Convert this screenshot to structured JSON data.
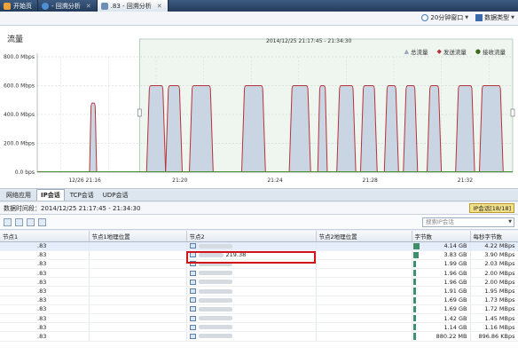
{
  "tabs": [
    {
      "label": "开始页",
      "icon": "home-icon",
      "active": false
    },
    {
      "label": "- 回溯分析",
      "icon": "globe-icon",
      "active": false
    },
    {
      "label": ".83 - 回溯分析",
      "icon": "analysis-icon",
      "active": true
    }
  ],
  "toolbar": {
    "window_label": "20分钟窗口",
    "data_type_label": "数据类型"
  },
  "chart": {
    "title": "流量",
    "overlay_range": "2014/12/25  21:17:45 - 21:34:30",
    "legend": [
      {
        "label": "总流量",
        "symbol": "▲",
        "color": "#9aa9b8"
      },
      {
        "label": "发送流量",
        "symbol": "◆",
        "color": "#b5333a"
      },
      {
        "label": "接收流量",
        "symbol": "●",
        "color": "#3e6a1f"
      }
    ]
  },
  "chart_data": {
    "type": "area",
    "ylim": [
      0,
      800
    ],
    "yticks": [
      "0.0 bps",
      "200.0 Mbps",
      "400.0 Mbps",
      "600.0 Mbps",
      "800.0 Mbps"
    ],
    "xticks": [
      "12/26 21:16",
      "21:20",
      "21:24",
      "21:28",
      "21:32"
    ],
    "grid": true,
    "legend_position": "top-right",
    "x_minutes": [
      15.0,
      17.0,
      19.0,
      21.0,
      23.0,
      25.0,
      27.0,
      29.0,
      31.0,
      33.0
    ],
    "series": [
      {
        "name": "发送流量",
        "bursts": [
          {
            "start": 16.2,
            "end": 16.5,
            "peak": 480
          },
          {
            "start": 18.6,
            "end": 19.4,
            "peak": 600
          },
          {
            "start": 19.4,
            "end": 20.1,
            "peak": 600
          },
          {
            "start": 20.4,
            "end": 21.4,
            "peak": 600
          },
          {
            "start": 22.6,
            "end": 23.6,
            "peak": 600
          },
          {
            "start": 24.6,
            "end": 25.5,
            "peak": 600
          },
          {
            "start": 25.8,
            "end": 26.2,
            "peak": 600
          },
          {
            "start": 26.6,
            "end": 27.4,
            "peak": 600
          },
          {
            "start": 27.6,
            "end": 28.3,
            "peak": 600
          },
          {
            "start": 28.6,
            "end": 29.2,
            "peak": 600
          },
          {
            "start": 29.4,
            "end": 30.0,
            "peak": 600
          },
          {
            "start": 30.4,
            "end": 31.0,
            "peak": 600
          },
          {
            "start": 31.6,
            "end": 32.4,
            "peak": 600
          },
          {
            "start": 32.6,
            "end": 33.6,
            "peak": 600
          }
        ]
      }
    ]
  },
  "subtabs": [
    {
      "label": "网络应用",
      "active": false
    },
    {
      "label": "IP会话",
      "active": true
    },
    {
      "label": "TCP会话",
      "active": false
    },
    {
      "label": "UDP会话",
      "active": false
    }
  ],
  "time_range_text": "数据时间段：2014/12/25  21:17:45 - 21:34:30",
  "session_count": "IP会话[18/18]",
  "search_placeholder": "搜索IP会话",
  "table": {
    "columns": [
      "节点1",
      "节点1地理位置",
      "节点2",
      "节点2地理位置",
      "字节数",
      "每秒字节数"
    ],
    "rows": [
      {
        "n1": ".83",
        "n2": "",
        "bytes": "4.14 GB",
        "rate": "4.22 MBps",
        "frac": 1.0
      },
      {
        "n1": ".83",
        "n2": "219.38",
        "bytes": "3.83 GB",
        "rate": "3.90 MBps",
        "frac": 0.92
      },
      {
        "n1": ".83",
        "n2": "",
        "bytes": "1.99 GB",
        "rate": "2.03 MBps",
        "frac": 0.48
      },
      {
        "n1": ".83",
        "n2": "",
        "bytes": "1.96 GB",
        "rate": "2.00 MBps",
        "frac": 0.47
      },
      {
        "n1": ".83",
        "n2": "",
        "bytes": "1.96 GB",
        "rate": "2.00 MBps",
        "frac": 0.47
      },
      {
        "n1": ".83",
        "n2": "",
        "bytes": "1.91 GB",
        "rate": "1.95 MBps",
        "frac": 0.46
      },
      {
        "n1": ".83",
        "n2": "",
        "bytes": "1.69 GB",
        "rate": "1.73 MBps",
        "frac": 0.41
      },
      {
        "n1": ".83",
        "n2": "",
        "bytes": "1.69 GB",
        "rate": "1.72 MBps",
        "frac": 0.41
      },
      {
        "n1": ".83",
        "n2": "",
        "bytes": "1.42 GB",
        "rate": "1.45 MBps",
        "frac": 0.34
      },
      {
        "n1": ".83",
        "n2": "",
        "bytes": "1.14 GB",
        "rate": "1.16 MBps",
        "frac": 0.28
      },
      {
        "n1": ".83",
        "n2": "",
        "bytes": "880.22 MB",
        "rate": "896.86 KBps",
        "frac": 0.21
      }
    ]
  }
}
